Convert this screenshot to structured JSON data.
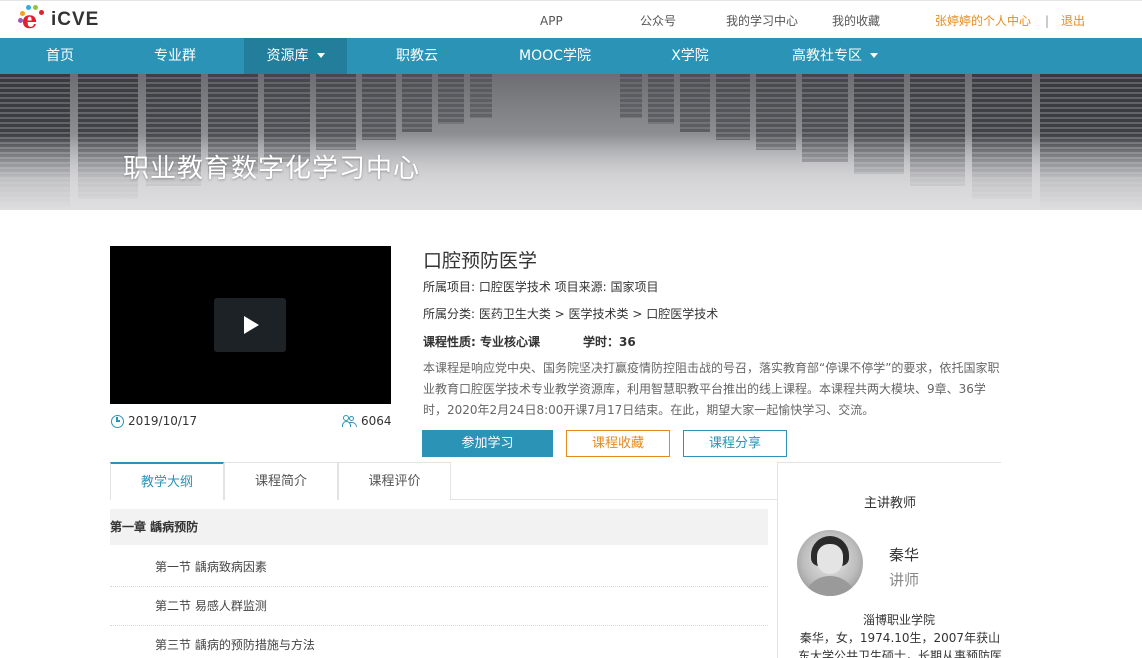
{
  "topbar": {
    "logo_text": "iCVE",
    "links": [
      "APP",
      "公众号",
      "我的学习中心",
      "我的收藏"
    ],
    "user_center": "张婷婷的个人中心",
    "separator": "|",
    "logout": "退出",
    "accent_color": "#e68a1c"
  },
  "nav": {
    "items": [
      "首页",
      "专业群",
      "资源库",
      "职教云",
      "MOOC学院",
      "X学院",
      "高教社专区"
    ],
    "active": "资源库",
    "color": "#2b93b5"
  },
  "banner": {
    "title": "职业教育数字化学习中心"
  },
  "course": {
    "date": "2019/10/17",
    "views": "6064",
    "title": "口腔预防医学",
    "project_line": "所属项目: 口腔医学技术   项目来源: 国家项目",
    "category_line": "所属分类: 医药卫生大类 > 医学技术类 > 口腔医学技术",
    "nature": "课程性质: 专业核心课",
    "hours": "学时：36",
    "description": "本课程是响应党中央、国务院坚决打赢疫情防控阻击战的号召，落实教育部“停课不停学”的要求，依托国家职业教育口腔医学技术专业教学资源库，利用智慧职教平台推出的线上课程。本课程共两大模块、9章、36学时，2020年2月24日8:00开课7月17日结束。在此，期望大家一起愉快学习、交流。",
    "join_btn": "参加学习",
    "fav_btn": "课程收藏",
    "share_btn": "课程分享"
  },
  "tabs": [
    "教学大纲",
    "课程简介",
    "课程评价"
  ],
  "outline": {
    "chapter": "第一章 龋病预防",
    "sections": [
      "第一节 龋病致病因素",
      "第二节 易感人群监测",
      "第三节 龋病的预防措施与方法"
    ]
  },
  "teacher": {
    "heading": "主讲教师",
    "name": "秦华",
    "title": "讲师",
    "school": "淄博职业学院",
    "bio": "秦华，女，1974.10生，2007年获山东大学公共卫生硕士，长期从事预防医"
  }
}
